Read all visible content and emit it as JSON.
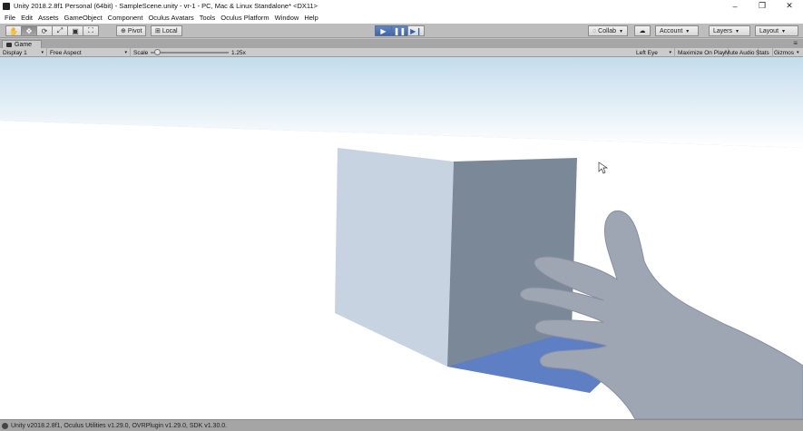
{
  "window": {
    "title": "Unity 2018.2.8f1 Personal (64bit) - SampleScene.unity - vr-1 - PC, Mac & Linux Standalone* <DX11>",
    "minimize": "–",
    "maximize": "❐",
    "close": "✕"
  },
  "menu": [
    "File",
    "Edit",
    "Assets",
    "GameObject",
    "Component",
    "Oculus Avatars",
    "Tools",
    "Oculus Platform",
    "Window",
    "Help"
  ],
  "toolbar": {
    "pivot_label": "Pivot",
    "local_label": "Local",
    "collab_label": "Collab",
    "account_label": "Account",
    "layers_label": "Layers",
    "layout_label": "Layout",
    "play_state": "playing"
  },
  "game": {
    "tab_label": "Game",
    "display_label": "Display 1",
    "aspect_label": "Free Aspect",
    "scale_label": "Scale",
    "scale_value": "1.25x",
    "scale_fraction": 0.08,
    "eye_label": "Left Eye",
    "maximize_label": "Maximize On Play",
    "mute_label": "Mute Audio",
    "stats_label": "Stats",
    "gizmos_label": "Gizmos"
  },
  "status": {
    "text": "Unity v2018.2.8f1, Oculus Utilities v1.29.0, OVRPlugin v1.29.0, SDK v1.30.0."
  },
  "colors": {
    "sky_top": "#cfe4f3",
    "ground": "#ffffff",
    "cube_front": "#c7d3e2",
    "cube_side": "#7a8797",
    "shadow": "#5f7fc4",
    "hand": "#9aa3b1",
    "play_accent": "#4a74b8"
  }
}
